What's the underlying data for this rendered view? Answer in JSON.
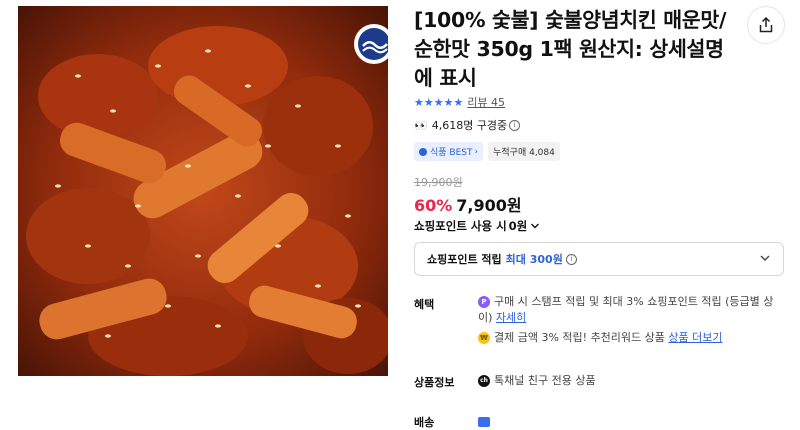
{
  "product": {
    "title": "[100% 숯불] 숯불양념치킨 매운맛/순한맛 350g 1팩 원산지: 상세설명에 표시",
    "stars": "★★★★★",
    "review_label": "리뷰 45",
    "viewers": "4,618명 구경중",
    "badge_best": "식품 BEST",
    "badge_sales": "누적구매 4,084",
    "original_price": "19,900원",
    "discount": "60%",
    "price": "7,900원"
  },
  "points": {
    "use_label": "쇼핑포인트 사용 시",
    "use_value": "0원",
    "earn_label": "쇼핑포인트 적립",
    "earn_max": "최대 300원"
  },
  "benefits": {
    "label": "혜택",
    "line1": "구매 시 스탬프 적립 및 최대 3% 쇼핑포인트 적립 (등급별 상이)",
    "line1_link": "자세히",
    "line2": "결제 금액 3% 적립! 추천리워드 상품",
    "line2_link": "상품 더보기"
  },
  "product_info": {
    "label": "상품정보",
    "value": "톡채널 친구 전용 상품"
  },
  "delivery": {
    "label": "배송"
  },
  "icons": {
    "logo": "brand-logo-icon",
    "share": "share-icon",
    "eyes": "eyes-icon",
    "chevron": "chevron-down-icon"
  },
  "colors": {
    "accent_blue": "#2e62d9",
    "discount_red": "#f2244b"
  }
}
